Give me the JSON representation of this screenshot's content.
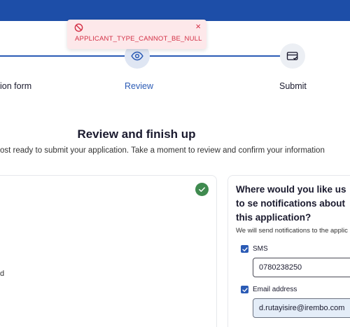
{
  "toast": {
    "message": "APPLICANT_TYPE_CANNOT_BE_NULL",
    "close_glyph": "×",
    "icon": "ban-icon"
  },
  "stepper": {
    "steps": [
      {
        "label": "ion form"
      },
      {
        "label": "Review",
        "icon": "eye-icon",
        "active": true
      },
      {
        "label": "Submit",
        "icon": "payment-card-icon"
      }
    ]
  },
  "page": {
    "heading": "Review and finish up",
    "subtitle": "ost ready to submit your application. Take a moment to review and confirm your information"
  },
  "left_card": {
    "stray_text": "d",
    "status_icon": "check-circle-icon"
  },
  "notifications": {
    "heading": "Where would you like us to se notifications about this application?",
    "description": "We will send notifications to the applic",
    "sms": {
      "label": "SMS",
      "checked": true,
      "value": "0780238250"
    },
    "email": {
      "label": "Email address",
      "checked": true,
      "value": "d.rutayisire@irembo.com"
    }
  },
  "colors": {
    "header": "#1d4ea8",
    "accent": "#2b5bb5",
    "error": "#d32f45",
    "error_bg": "#fde8ea",
    "success": "#3f8a4f"
  }
}
